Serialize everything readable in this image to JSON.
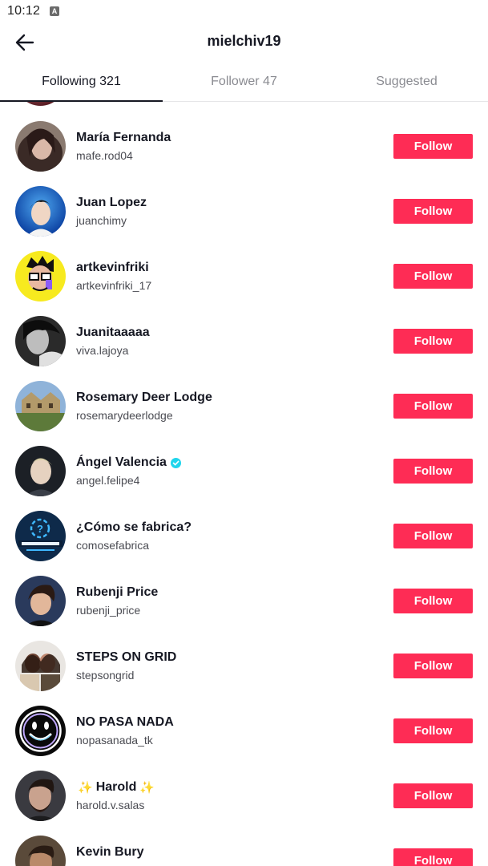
{
  "status_bar": {
    "time": "10:12",
    "indicator": "A"
  },
  "header": {
    "title": "mielchiv19",
    "back_icon": "arrow-left-icon"
  },
  "tabs": [
    {
      "label": "Following 321",
      "active": true
    },
    {
      "label": "Follower 47",
      "active": false
    },
    {
      "label": "Suggested",
      "active": false
    }
  ],
  "follow_label": "Follow",
  "accent_color": "#fe2c55",
  "users": [
    {
      "name": "María Fernanda",
      "handle": "mafe.rod04"
    },
    {
      "name": "Juan Lopez",
      "handle": "juanchimy"
    },
    {
      "name": "artkevinfriki",
      "handle": "artkevinfriki_17"
    },
    {
      "name": "Juanitaaaaa",
      "handle": "viva.lajoya"
    },
    {
      "name": "Rosemary Deer Lodge",
      "handle": "rosemarydeerlodge"
    },
    {
      "name": "Ángel Valencia",
      "handle": "angel.felipe4",
      "verified": true
    },
    {
      "name": "¿Cómo se fabrica?",
      "handle": "comosefabrica"
    },
    {
      "name": "Rubenji Price",
      "handle": "rubenji_price"
    },
    {
      "name": "STEPS ON GRID",
      "handle": "stepsongrid"
    },
    {
      "name": "NO PASA NADA",
      "handle": "nopasanada_tk"
    },
    {
      "name": "Harold",
      "handle": "harold.v.salas",
      "sparkles": "✨"
    },
    {
      "name": "Kevin Bury",
      "handle": ""
    }
  ]
}
